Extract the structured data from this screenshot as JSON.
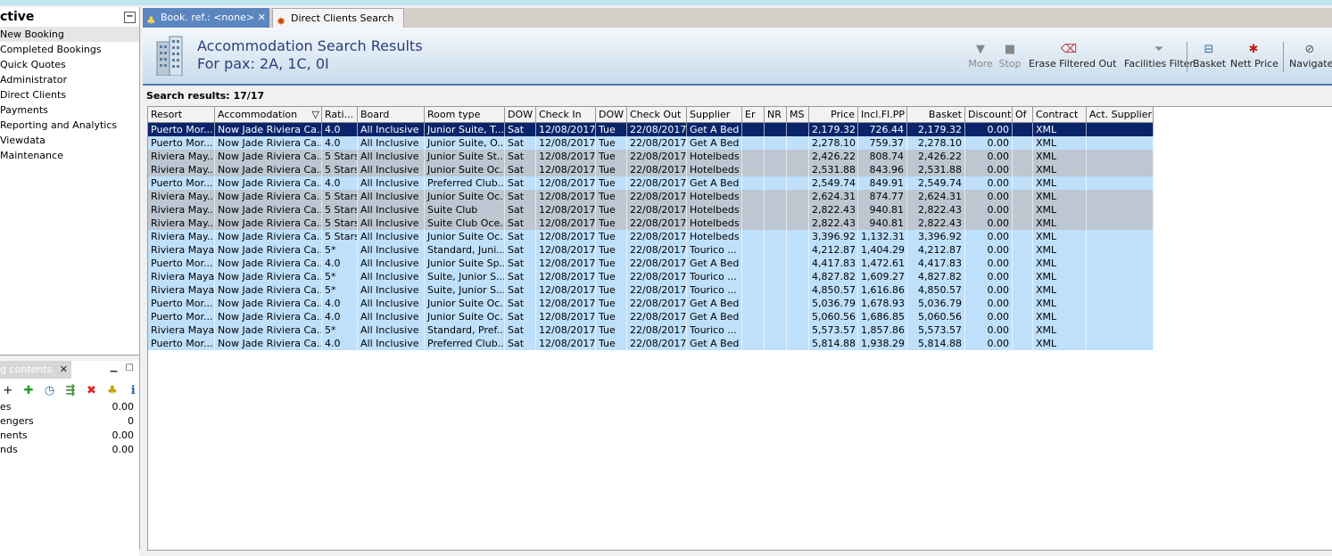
{
  "left_panel": {
    "header": "ctive",
    "nav_items": [
      "New Booking",
      "Completed Bookings",
      "Quick Quotes",
      "Administrator",
      "Direct Clients",
      "Payments",
      "Reporting and Analytics",
      "Viewdata",
      "Maintenance"
    ],
    "booking_tab": "g contents",
    "summary": [
      {
        "label": "es",
        "value": "0.00"
      },
      {
        "label": "engers",
        "value": "0"
      },
      {
        "label": "nents",
        "value": "0.00"
      },
      {
        "label": "nds",
        "value": "0.00"
      }
    ]
  },
  "tabs": [
    {
      "label": "Book. ref.: <none>"
    },
    {
      "label": "Direct Clients Search"
    }
  ],
  "header": {
    "title": "Accommodation Search Results",
    "subtitle": "For pax: 2A, 1C, 0I"
  },
  "toolbar": {
    "more": "More",
    "stop": "Stop",
    "erase": "Erase Filtered Out",
    "facilities": "Facilities Filter",
    "basket": "Basket",
    "nett": "Nett Price",
    "navigate": "Navigate"
  },
  "results_label": "Search results: 17/17",
  "columns": [
    "Resort",
    "Accommodation",
    "Rati...",
    "Board",
    "Room type",
    "DOW",
    "Check In",
    "DOW",
    "Check Out",
    "Supplier",
    "Er",
    "NR",
    "MS",
    "Price",
    "Incl.Fl.PP",
    "Basket",
    "Discount",
    "Of",
    "Contract",
    "Act. Supplier"
  ],
  "rows": [
    [
      "Puerto Mor...",
      "Now Jade Riviera Ca...",
      "4.0",
      "All Inclusive",
      "Junior Suite, T...",
      "Sat",
      "12/08/2017",
      "Tue",
      "22/08/2017",
      "Get A Bed",
      "",
      "",
      "",
      "2,179.32",
      "726.44",
      "2,179.32",
      "0.00",
      "",
      "XML",
      ""
    ],
    [
      "Puerto Mor...",
      "Now Jade Riviera Ca...",
      "4.0",
      "All Inclusive",
      "Junior Suite, O...",
      "Sat",
      "12/08/2017",
      "Tue",
      "22/08/2017",
      "Get A Bed",
      "",
      "",
      "",
      "2,278.10",
      "759.37",
      "2,278.10",
      "0.00",
      "",
      "XML",
      ""
    ],
    [
      "Riviera May...",
      "Now Jade  Riviera Ca...",
      "5 Stars",
      "All Inclusive",
      "Junior Suite St...",
      "Sat",
      "12/08/2017",
      "Tue",
      "22/08/2017",
      "Hotelbeds",
      "",
      "",
      "",
      "2,426.22",
      "808.74",
      "2,426.22",
      "0.00",
      "",
      "XML",
      ""
    ],
    [
      "Riviera May...",
      "Now Jade  Riviera Ca...",
      "5 Stars",
      "All Inclusive",
      "Junior Suite Oc...",
      "Sat",
      "12/08/2017",
      "Tue",
      "22/08/2017",
      "Hotelbeds",
      "",
      "",
      "",
      "2,531.88",
      "843.96",
      "2,531.88",
      "0.00",
      "",
      "XML",
      ""
    ],
    [
      "Puerto Mor...",
      "Now Jade Riviera Ca...",
      "4.0",
      "All Inclusive",
      "Preferred Club...",
      "Sat",
      "12/08/2017",
      "Tue",
      "22/08/2017",
      "Get A Bed",
      "",
      "",
      "",
      "2,549.74",
      "849.91",
      "2,549.74",
      "0.00",
      "",
      "XML",
      ""
    ],
    [
      "Riviera May...",
      "Now Jade  Riviera Ca...",
      "5 Stars",
      "All Inclusive",
      "Junior Suite Oc...",
      "Sat",
      "12/08/2017",
      "Tue",
      "22/08/2017",
      "Hotelbeds",
      "",
      "",
      "",
      "2,624.31",
      "874.77",
      "2,624.31",
      "0.00",
      "",
      "XML",
      ""
    ],
    [
      "Riviera May...",
      "Now Jade  Riviera Ca...",
      "5 Stars",
      "All Inclusive",
      "Suite Club",
      "Sat",
      "12/08/2017",
      "Tue",
      "22/08/2017",
      "Hotelbeds",
      "",
      "",
      "",
      "2,822.43",
      "940.81",
      "2,822.43",
      "0.00",
      "",
      "XML",
      ""
    ],
    [
      "Riviera May...",
      "Now Jade  Riviera Ca...",
      "5 Stars",
      "All Inclusive",
      "Suite Club Oce...",
      "Sat",
      "12/08/2017",
      "Tue",
      "22/08/2017",
      "Hotelbeds",
      "",
      "",
      "",
      "2,822.43",
      "940.81",
      "2,822.43",
      "0.00",
      "",
      "XML",
      ""
    ],
    [
      "Riviera May...",
      "Now Jade  Riviera Ca...",
      "5 Stars",
      "All Inclusive",
      "Junior Suite Oc...",
      "Sat",
      "12/08/2017",
      "Tue",
      "22/08/2017",
      "Hotelbeds",
      "",
      "",
      "",
      "3,396.92",
      "1,132.31",
      "3,396.92",
      "0.00",
      "",
      "XML",
      ""
    ],
    [
      "Riviera Maya",
      "Now Jade Riviera Ca...",
      "5*",
      "All Inclusive",
      "Standard, Juni...",
      "Sat",
      "12/08/2017",
      "Tue",
      "22/08/2017",
      "Tourico ...",
      "",
      "",
      "",
      "4,212.87",
      "1,404.29",
      "4,212.87",
      "0.00",
      "",
      "XML",
      ""
    ],
    [
      "Puerto Mor...",
      "Now Jade Riviera Ca...",
      "4.0",
      "All Inclusive",
      "Junior Suite Sp...",
      "Sat",
      "12/08/2017",
      "Tue",
      "22/08/2017",
      "Get A Bed",
      "",
      "",
      "",
      "4,417.83",
      "1,472.61",
      "4,417.83",
      "0.00",
      "",
      "XML",
      ""
    ],
    [
      "Riviera Maya",
      "Now Jade Riviera Ca...",
      "5*",
      "All Inclusive",
      "Suite, Junior S...",
      "Sat",
      "12/08/2017",
      "Tue",
      "22/08/2017",
      "Tourico ...",
      "",
      "",
      "",
      "4,827.82",
      "1,609.27",
      "4,827.82",
      "0.00",
      "",
      "XML",
      ""
    ],
    [
      "Riviera Maya",
      "Now Jade Riviera Ca...",
      "5*",
      "All Inclusive",
      "Suite, Junior S...",
      "Sat",
      "12/08/2017",
      "Tue",
      "22/08/2017",
      "Tourico ...",
      "",
      "",
      "",
      "4,850.57",
      "1,616.86",
      "4,850.57",
      "0.00",
      "",
      "XML",
      ""
    ],
    [
      "Puerto Mor...",
      "Now Jade Riviera Ca...",
      "4.0",
      "All Inclusive",
      "Junior Suite Oc...",
      "Sat",
      "12/08/2017",
      "Tue",
      "22/08/2017",
      "Get A Bed",
      "",
      "",
      "",
      "5,036.79",
      "1,678.93",
      "5,036.79",
      "0.00",
      "",
      "XML",
      ""
    ],
    [
      "Puerto Mor...",
      "Now Jade Riviera Ca...",
      "4.0",
      "All Inclusive",
      "Junior Suite Oc...",
      "Sat",
      "12/08/2017",
      "Tue",
      "22/08/2017",
      "Get A Bed",
      "",
      "",
      "",
      "5,060.56",
      "1,686.85",
      "5,060.56",
      "0.00",
      "",
      "XML",
      ""
    ],
    [
      "Riviera Maya",
      "Now Jade Riviera Ca...",
      "5*",
      "All Inclusive",
      "Standard, Pref...",
      "Sat",
      "12/08/2017",
      "Tue",
      "22/08/2017",
      "Tourico ...",
      "",
      "",
      "",
      "5,573.57",
      "1,857.86",
      "5,573.57",
      "0.00",
      "",
      "XML",
      ""
    ],
    [
      "Puerto Mor...",
      "Now Jade Riviera Ca...",
      "4.0",
      "All Inclusive",
      "Preferred Club...",
      "Sat",
      "12/08/2017",
      "Tue",
      "22/08/2017",
      "Get A Bed",
      "",
      "",
      "",
      "5,814.88",
      "1,938.29",
      "5,814.88",
      "0.00",
      "",
      "XML",
      ""
    ]
  ],
  "row_styles": [
    "sel",
    "blue",
    "grey",
    "grey",
    "blue",
    "grey",
    "grey",
    "grey",
    "blue",
    "blue",
    "blue",
    "blue",
    "blue",
    "blue",
    "blue",
    "blue",
    "blue"
  ],
  "colors": {
    "selected_row": "#0a246a",
    "blue_row": "#bfe0fb",
    "grey_row": "#bcc7d1",
    "title": "#2a3f7a"
  }
}
